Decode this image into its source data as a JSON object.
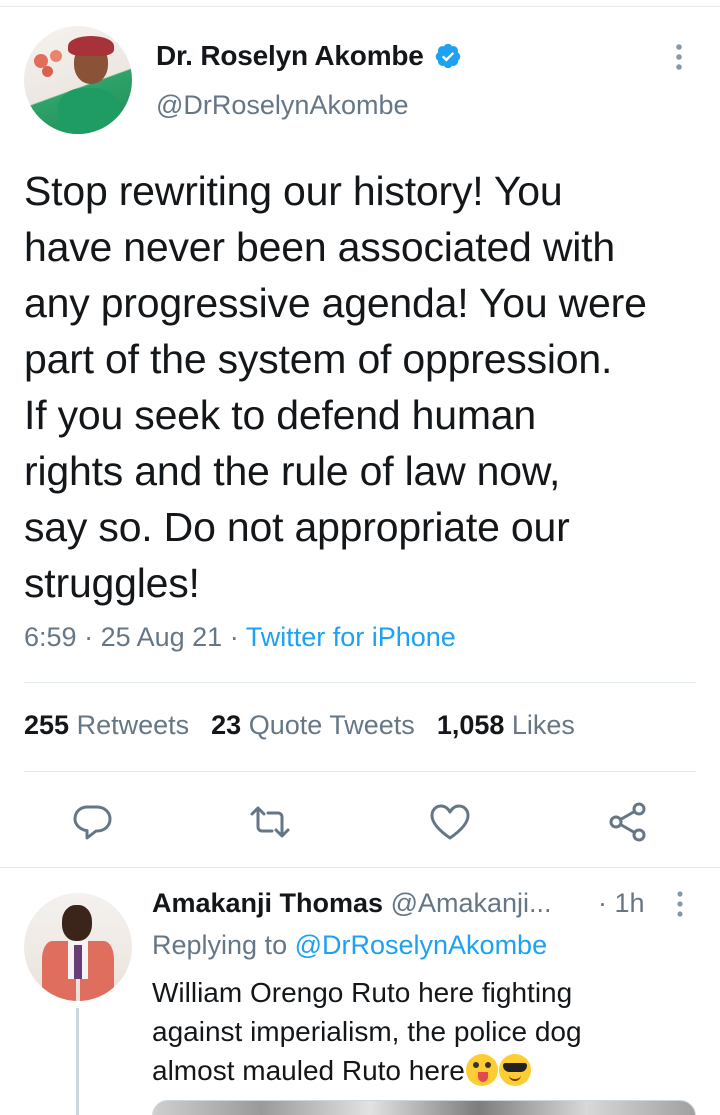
{
  "tweet": {
    "author_name": "Dr. Roselyn Akombe",
    "author_handle": "@DrRoselynAkombe",
    "text_lines": [
      "Stop rewriting our history! You",
      "have never been associated with",
      "any progressive agenda! You were",
      "part of the system of oppression.",
      "If you seek to defend human",
      "rights and the rule of law now,",
      "say so. Do not appropriate our",
      "struggles!"
    ],
    "time": "6:59",
    "date": "25 Aug 21",
    "separator": " · ",
    "source": "Twitter for iPhone"
  },
  "stats": {
    "retweets_count": "255",
    "retweets_label": "Retweets",
    "quotes_count": "23",
    "quotes_label": "Quote Tweets",
    "likes_count": "1,058",
    "likes_label": "Likes"
  },
  "actions": [
    "reply-icon",
    "retweet-icon",
    "like-icon",
    "share-icon"
  ],
  "reply": {
    "author_name": "Amakanji Thomas",
    "author_handle": "@Amakanji...",
    "time": "· 1h",
    "replying_prefix": "Replying to ",
    "replying_to": "@DrRoselynAkombe",
    "text_lines": [
      "William Orengo Ruto here fighting",
      "against imperialism, the police dog",
      "almost mauled Ruto here"
    ],
    "emojis": [
      "zany-face-emoji",
      "sunglasses-face-emoji"
    ]
  },
  "colors": {
    "accent": "#1da1f2",
    "text": "#14171a",
    "muted": "#657786",
    "divider": "#e1e8ed"
  }
}
